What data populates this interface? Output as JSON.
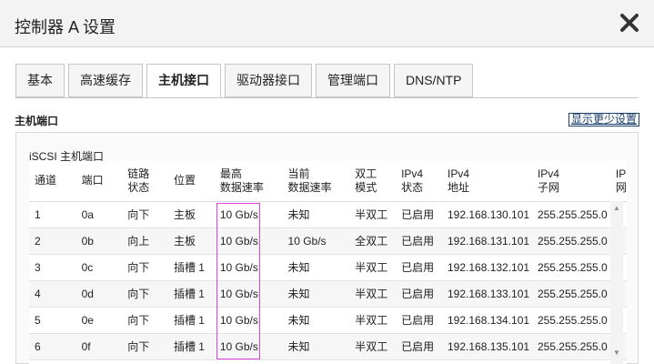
{
  "dialog": {
    "title": "控制器 A 设置",
    "close_icon": "close-icon"
  },
  "tabs": [
    {
      "label": "基本",
      "active": false
    },
    {
      "label": "高速缓存",
      "active": false
    },
    {
      "label": "主机接口",
      "active": true
    },
    {
      "label": "驱动器接口",
      "active": false
    },
    {
      "label": "管理端口",
      "active": false
    },
    {
      "label": "DNS/NTP",
      "active": false
    }
  ],
  "section": {
    "title": "主机端口",
    "show_less": "显示更少设置"
  },
  "panel": {
    "title": "iSCSI 主机端口"
  },
  "table": {
    "headers": [
      "通道",
      "端口",
      "链路\n状态",
      "位置",
      "最高\n数据速率",
      "当前\n数据速率",
      "双工\n模式",
      "IPv4\n状态",
      "IPv4\n地址",
      "IPv4\n子网",
      "IP\n网"
    ],
    "rows": [
      [
        "1",
        "0a",
        "向下",
        "主板",
        "10 Gb/s",
        "未知",
        "半双工",
        "已启用",
        "192.168.130.101",
        "255.255.255.0",
        ""
      ],
      [
        "2",
        "0b",
        "向上",
        "主板",
        "10 Gb/s",
        "10 Gb/s",
        "全双工",
        "已启用",
        "192.168.131.101",
        "255.255.255.0",
        ""
      ],
      [
        "3",
        "0c",
        "向下",
        "插槽 1",
        "10 Gb/s",
        "未知",
        "半双工",
        "已启用",
        "192.168.132.101",
        "255.255.255.0",
        ""
      ],
      [
        "4",
        "0d",
        "向下",
        "插槽 1",
        "10 Gb/s",
        "未知",
        "半双工",
        "已启用",
        "192.168.133.101",
        "255.255.255.0",
        ""
      ],
      [
        "5",
        "0e",
        "向下",
        "插槽 1",
        "10 Gb/s",
        "未知",
        "半双工",
        "已启用",
        "192.168.134.101",
        "255.255.255.0",
        ""
      ],
      [
        "6",
        "0f",
        "向下",
        "插槽 1",
        "10 Gb/s",
        "未知",
        "半双工",
        "已启用",
        "192.168.135.101",
        "255.255.255.0",
        ""
      ]
    ]
  },
  "colors": {
    "highlight": "#e040e0",
    "link": "#1a3f6b"
  }
}
